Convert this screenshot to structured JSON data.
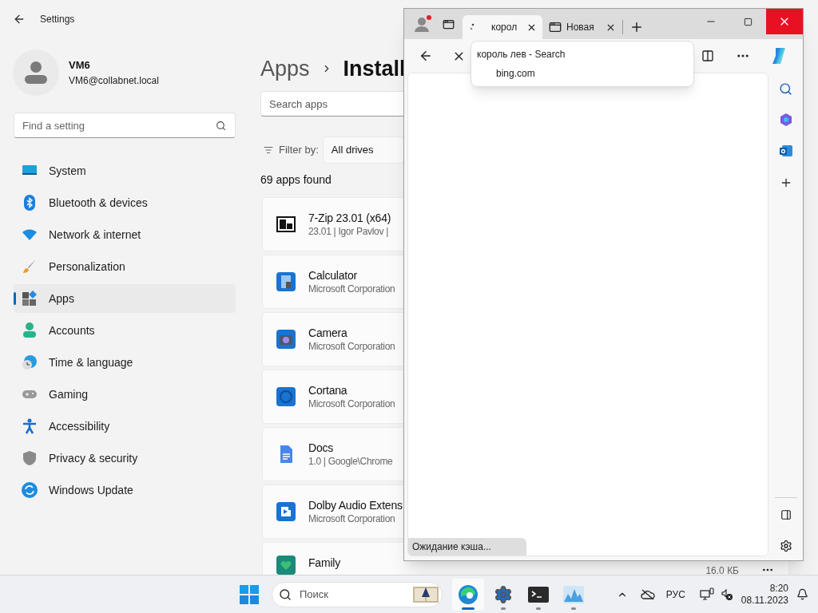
{
  "settings": {
    "title": "Settings",
    "user": {
      "name": "VM6",
      "email": "VM6@collabnet.local"
    },
    "search": {
      "placeholder": "Find a setting"
    },
    "nav": [
      {
        "label": "System",
        "selected": false
      },
      {
        "label": "Bluetooth & devices",
        "selected": false
      },
      {
        "label": "Network & internet",
        "selected": false
      },
      {
        "label": "Personalization",
        "selected": false
      },
      {
        "label": "Apps",
        "selected": true
      },
      {
        "label": "Accounts",
        "selected": false
      },
      {
        "label": "Time & language",
        "selected": false
      },
      {
        "label": "Gaming",
        "selected": false
      },
      {
        "label": "Accessibility",
        "selected": false
      },
      {
        "label": "Privacy & security",
        "selected": false
      },
      {
        "label": "Windows Update",
        "selected": false
      }
    ],
    "breadcrumb": [
      "Apps",
      "Install"
    ],
    "apps_search": {
      "placeholder": "Search apps"
    },
    "filter": {
      "label": "Filter by:",
      "value": "All drives"
    },
    "count": "69 apps found",
    "apps": [
      {
        "name": "7-Zip 23.01 (x64)",
        "detail": "23.01  |  Igor Pavlov  |"
      },
      {
        "name": "Calculator",
        "detail": "Microsoft Corporation"
      },
      {
        "name": "Camera",
        "detail": "Microsoft Corporation"
      },
      {
        "name": "Cortana",
        "detail": "Microsoft Corporation"
      },
      {
        "name": "Docs",
        "detail": "1.0  |  Google\\Chrome"
      },
      {
        "name": "Dolby Audio Extens",
        "detail": "Microsoft Corporation"
      },
      {
        "name": "Family",
        "size": "16.0 КБ"
      }
    ]
  },
  "browser": {
    "tabs": [
      {
        "title": "корол",
        "selected": true
      },
      {
        "title": "Новая",
        "selected": false
      }
    ],
    "tooltip": {
      "title": "король лев - Search",
      "url": "bing.com"
    },
    "status": "Ожидание кэша..."
  },
  "taskbar": {
    "search": {
      "placeholder": "Поиск"
    },
    "apps": [
      {
        "selected": true
      },
      {
        "selected": false
      },
      {
        "selected": false
      },
      {
        "selected": false
      }
    ],
    "language": "РУС",
    "time": "8:20",
    "date": "08.11.2023"
  }
}
